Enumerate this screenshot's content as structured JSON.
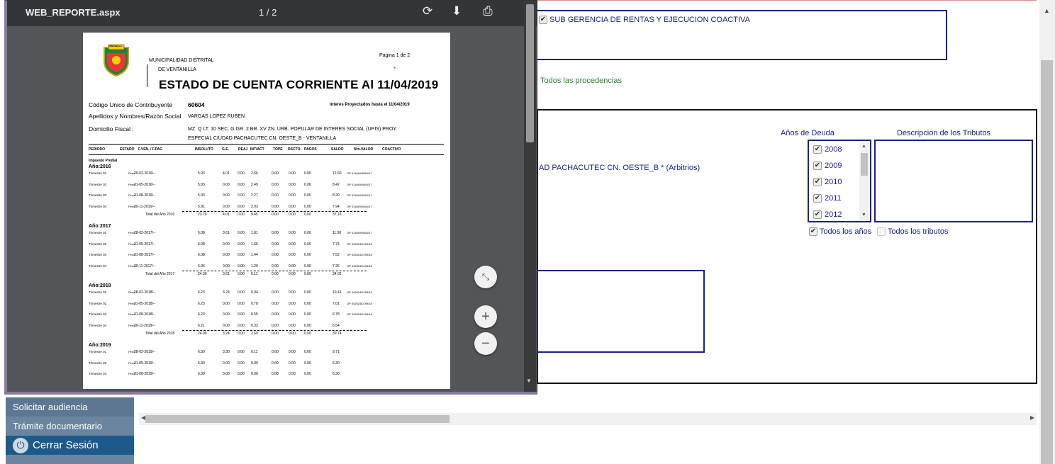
{
  "viewer": {
    "title": "WEB_REPORTE.aspx",
    "page_indicator": "1 / 2",
    "icons": [
      "rotate-icon",
      "download-icon",
      "print-icon"
    ],
    "zoom_buttons": {
      "fit": "⤡",
      "plus": "+",
      "minus": "−"
    }
  },
  "report": {
    "municipality_line1": "MUNICIPALIDAD DISTRITAL",
    "municipality_line2": "DE VENTANILLA",
    "logo_text": "VENTANILLA",
    "page_label": "Pagina 1 de 2",
    "title": "ESTADO DE CUENTA CORRIENTE Al 11/04/2019",
    "codigo_label": "Código Unico de Contribuyente",
    "codigo_value": "60604",
    "interes_label": "Interes Proyectados hasta el 11/04/2019",
    "nombre_label": "Apellidos y Nombres/Razón Social",
    "nombre_value": "VARGAS LOPEZ RUBEN",
    "domicilio_label": "Domicilio Fiscal :",
    "domicilio_line1": "MZ. Q LT. 10 SEC. G GR. 2 BR. XV ZN. URB. POPULAR DE INTERES SOCIAL (UPIS) PROY.",
    "domicilio_line2": "ESPECIAL CIUDAD PACHACUTEC CN. OESTE_B  - VENTANILLA",
    "columns": [
      "PERIODO",
      "ESTADO",
      "F.VEN. / F.PAG",
      "INSOLUTO",
      "G.E.",
      "REAJ",
      "INT/ACT",
      "TOPE",
      "DSCTO.",
      "PAGOS",
      "SALDO",
      "Nro.VALOR",
      "COACTIVO"
    ],
    "section_label": "Impuesto Predial",
    "years": [
      {
        "label": "Año:2016",
        "rows": [
          {
            "p": "Trimestre 01",
            "e": "Pend",
            "f": "29-02-2016/--",
            "ins": "5.93",
            "ge": "4.01",
            "re": "0.00",
            "int": "2.66",
            "tope": "0.00",
            "dsc": "0.00",
            "pag": "0.00",
            "sal": "12.60",
            "nro": "OP 011649/0064/17"
          },
          {
            "p": "Trimestre 02",
            "e": "Pend",
            "f": "31-05-2016/--",
            "ins": "5.93",
            "ge": "0.00",
            "re": "0.00",
            "int": "2.49",
            "tope": "0.00",
            "dsc": "0.00",
            "pag": "0.00",
            "sal": "8.42",
            "nro": "OP 011649/0064/17"
          },
          {
            "p": "Trimestre 03",
            "e": "Pend",
            "f": "31-08-2016/--",
            "ins": "5.93",
            "ge": "0.00",
            "re": "0.00",
            "int": "2.27",
            "tope": "0.00",
            "dsc": "0.00",
            "pag": "0.00",
            "sal": "8.20",
            "nro": "OP 011649/0064/17"
          },
          {
            "p": "Trimestre 04",
            "e": "Pend",
            "f": "30-11-2016/--",
            "ins": "5.91",
            "ge": "0.00",
            "re": "0.00",
            "int": "2.03",
            "tope": "0.00",
            "dsc": "0.00",
            "pag": "0.00",
            "sal": "7.94",
            "nro": "OP 011649/0064/17"
          }
        ],
        "total": {
          "label": "Total del Año 2016",
          "ins": "23.70",
          "ge": "4.01",
          "re": "0.00",
          "int": "9.45",
          "tope": "0.00",
          "dsc": "0.00",
          "pag": "0.00",
          "sal": "37.16"
        }
      },
      {
        "label": "Año:2017",
        "rows": [
          {
            "p": "Trimestre 01",
            "e": "Pend",
            "f": "28-02-2017/--",
            "ins": "6.08",
            "ge": "3.61",
            "re": "0.00",
            "int": "1.81",
            "tope": "0.00",
            "dsc": "0.00",
            "pag": "0.00",
            "sal": "11.50",
            "nro": "OP 011649/0064/17"
          },
          {
            "p": "Trimestre 02",
            "e": "Pend",
            "f": "31-05-2017/--",
            "ins": "6.08",
            "ge": "0.00",
            "re": "0.00",
            "int": "1.66",
            "tope": "0.00",
            "dsc": "0.00",
            "pag": "0.00",
            "sal": "7.74",
            "nro": "OP 042824/0199/18"
          },
          {
            "p": "Trimestre 03",
            "e": "Pend",
            "f": "31-08-2017/--",
            "ins": "6.08",
            "ge": "0.00",
            "re": "0.00",
            "int": "1.44",
            "tope": "0.00",
            "dsc": "0.00",
            "pag": "0.00",
            "sal": "7.52",
            "nro": "OP 042824/0199/18"
          },
          {
            "p": "Trimestre 04",
            "e": "Pend",
            "f": "30-11-2017/--",
            "ins": "6.06",
            "ge": "0.00",
            "re": "0.00",
            "int": "1.20",
            "tope": "0.00",
            "dsc": "0.00",
            "pag": "0.00",
            "sal": "7.26",
            "nro": "OP 042824/0199/18"
          }
        ],
        "total": {
          "label": "Total del Año 2017",
          "ins": "24.30",
          "ge": "3.61",
          "re": "0.00",
          "int": "6.11",
          "tope": "0.00",
          "dsc": "0.00",
          "pag": "0.00",
          "sal": "34.02"
        }
      },
      {
        "label": "Año:2018",
        "rows": [
          {
            "p": "Trimestre 01",
            "e": "Pend",
            "f": "28-02-2018/--",
            "ins": "6.23",
            "ge": "3.24",
            "re": "0.00",
            "int": "0.94",
            "tope": "0.00",
            "dsc": "0.00",
            "pag": "0.00",
            "sal": "10.41",
            "nro": "OP 042824/0199/18"
          },
          {
            "p": "Trimestre 02",
            "e": "Pend",
            "f": "31-05-2018/--",
            "ins": "6.23",
            "ge": "0.00",
            "re": "0.00",
            "int": "0.78",
            "tope": "0.00",
            "dsc": "0.00",
            "pag": "0.00",
            "sal": "7.01",
            "nro": "OP 042824/0199/18"
          },
          {
            "p": "Trimestre 03",
            "e": "Pend",
            "f": "31-08-2018/--",
            "ins": "6.23",
            "ge": "0.00",
            "re": "0.00",
            "int": "0.55",
            "tope": "0.00",
            "dsc": "0.00",
            "pag": "0.00",
            "sal": "6.78",
            "nro": "OP 042824/0199/18"
          },
          {
            "p": "Trimestre 04",
            "e": "Pend",
            "f": "30-11-2018/--",
            "ins": "6.21",
            "ge": "0.00",
            "re": "0.00",
            "int": "0.33",
            "tope": "0.00",
            "dsc": "0.00",
            "pag": "0.00",
            "sal": "6.54",
            "nro": ""
          }
        ],
        "total": {
          "label": "Total del Año 2018",
          "ins": "24.90",
          "ge": "3.24",
          "re": "0.00",
          "int": "2.60",
          "tope": "0.00",
          "dsc": "0.00",
          "pag": "0.00",
          "sal": "30.74"
        }
      },
      {
        "label": "Año:2019",
        "rows": [
          {
            "p": "Trimestre 01",
            "e": "Pend",
            "f": "28-02-2019/--",
            "ins": "6.30",
            "ge": "3.30",
            "re": "0.00",
            "int": "0.11",
            "tope": "0.00",
            "dsc": "0.00",
            "pag": "0.00",
            "sal": "9.71",
            "nro": ""
          },
          {
            "p": "Trimestre 02",
            "e": "Pend",
            "f": "31-05-2019/--",
            "ins": "6.30",
            "ge": "0.00",
            "re": "0.00",
            "int": "0.00",
            "tope": "0.00",
            "dsc": "0.00",
            "pag": "0.00",
            "sal": "6.30",
            "nro": ""
          },
          {
            "p": "Trimestre 03",
            "e": "Pend",
            "f": "31-08-2019/--",
            "ins": "6.30",
            "ge": "0.00",
            "re": "0.00",
            "int": "0.00",
            "tope": "0.00",
            "dsc": "0.00",
            "pag": "0.00",
            "sal": "6.30",
            "nro": ""
          }
        ],
        "total": null
      }
    ]
  },
  "form": {
    "subgerencia": "SUB GERENCIA DE RENTAS Y EJECUCION COACTIVA",
    "procedencias": "Todos las procedencias",
    "anos_label": "Años de Deuda",
    "desc_label": "Descripcion de los Tributos",
    "address_item": "AD PACHACUTEC CN. OESTE_B * (Arbitrios)",
    "years": [
      "2008",
      "2009",
      "2010",
      "2011",
      "2012"
    ],
    "todos_anos": "Todos los años",
    "todos_tributos": "Todos los tributos"
  },
  "menu": {
    "solicitar": "Solicitar audiencia",
    "tramite": "Trámite documentario",
    "cerrar": "Cerrar Sesión"
  },
  "colors": {
    "navy": "#1a237e",
    "green": "#2e7d32",
    "menu_blue": "#1d5a8a",
    "viewer_bar": "#323639"
  }
}
